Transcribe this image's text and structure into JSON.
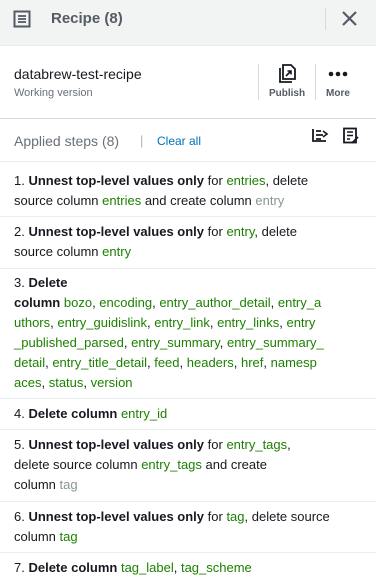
{
  "header": {
    "title": "Recipe (8)",
    "menu_icon": "list-icon",
    "close_icon": "close-icon"
  },
  "recipe": {
    "name": "databrew-test-recipe",
    "version": "Working version",
    "publish_label": "Publish",
    "more_label": "More"
  },
  "steps_header": {
    "title": "Applied steps (8)",
    "separator": "|",
    "clear_all": "Clear all"
  },
  "steps": {
    "s1": {
      "num": "1.",
      "action": "Unnest top-level values only",
      "w_for": "for",
      "col": "entries",
      "w_delete": ", delete",
      "w_source": "source column",
      "col2": "entries",
      "w_create": "and create column",
      "new_col": "entry"
    },
    "s2": {
      "num": "2.",
      "action": "Unnest top-level values only",
      "w_for": "for",
      "col": "entry",
      "w_delete": ", delete",
      "w_source": "source column",
      "col2": "entry"
    },
    "s3": {
      "num": "3.",
      "action": "Delete",
      "w_column": "column",
      "lines": [
        [
          "bozo",
          "encoding",
          "entry_author_detail",
          "entry_a"
        ],
        [
          "uthors",
          "entry_guidislink",
          "entry_link",
          "entry_links",
          "entry"
        ],
        [
          "_published_parsed",
          "entry_summary",
          "entry_summary_"
        ],
        [
          "detail",
          "entry_title_detail",
          "feed",
          "headers",
          "href",
          "namesp"
        ],
        [
          "aces",
          "status",
          "version"
        ]
      ]
    },
    "s4": {
      "num": "4.",
      "action": "Delete column",
      "col": "entry_id"
    },
    "s5": {
      "num": "5.",
      "action": "Unnest top-level values only",
      "w_for": "for",
      "col": "entry_tags",
      "w_delete": "delete source column",
      "col2": "entry_tags",
      "w_create": "and create",
      "w_column": "column",
      "new_col": "tag"
    },
    "s6": {
      "num": "6.",
      "action": "Unnest top-level values only",
      "w_for": "for",
      "col": "tag",
      "w_delete": ", delete source",
      "w_column": "column",
      "col2": "tag"
    },
    "s7": {
      "num": "7.",
      "action": "Delete column",
      "col": "tag_label",
      "col2": "tag_scheme"
    }
  }
}
